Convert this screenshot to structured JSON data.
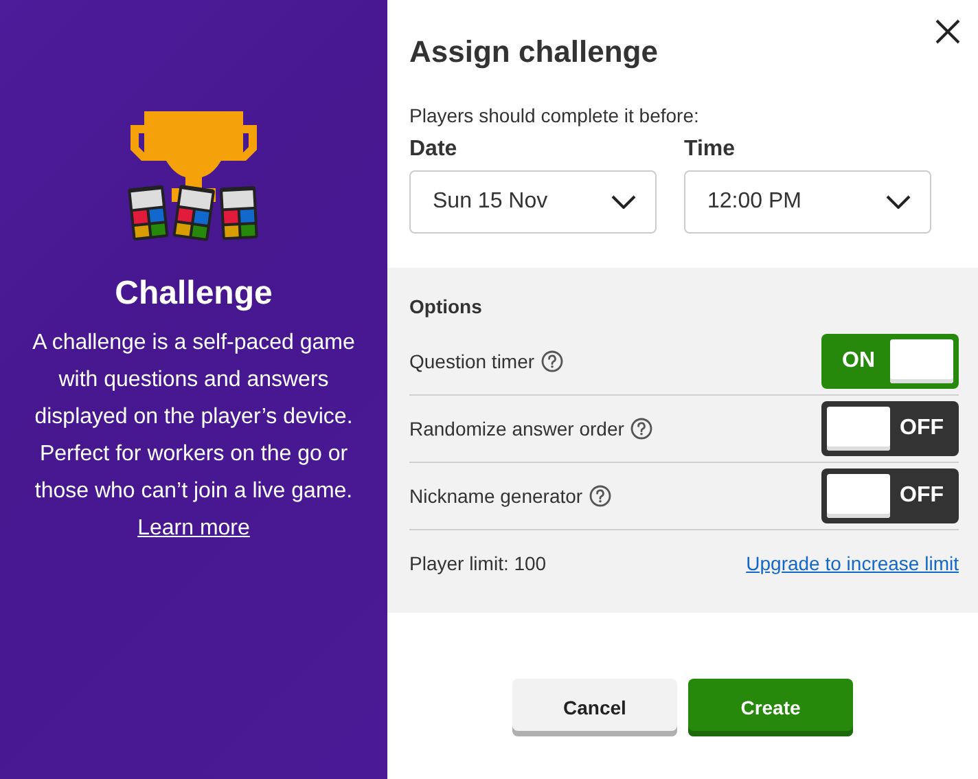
{
  "promo": {
    "title": "Challenge",
    "description": "A challenge is a self-paced game with questions and answers displayed on the player’s device. Perfect for workers on the go or those who can’t join a live game.",
    "link": "Learn more"
  },
  "dialog": {
    "title": "Assign challenge",
    "deadline_hint": "Players should complete it before:",
    "date": {
      "label": "Date",
      "value": "Sun 15 Nov"
    },
    "time": {
      "label": "Time",
      "value": "12:00 PM"
    },
    "options": {
      "heading": "Options",
      "toggles": [
        {
          "label": "Question timer",
          "on": true,
          "state_label": "ON"
        },
        {
          "label": "Randomize answer order",
          "on": false,
          "state_label": "OFF"
        },
        {
          "label": "Nickname generator",
          "on": false,
          "state_label": "OFF"
        }
      ],
      "player_limit": "Player limit: 100",
      "upgrade_link": "Upgrade to increase limit"
    },
    "buttons": [
      {
        "label": "Cancel",
        "kind": "secondary"
      },
      {
        "label": "Create",
        "kind": "primary"
      }
    ]
  }
}
